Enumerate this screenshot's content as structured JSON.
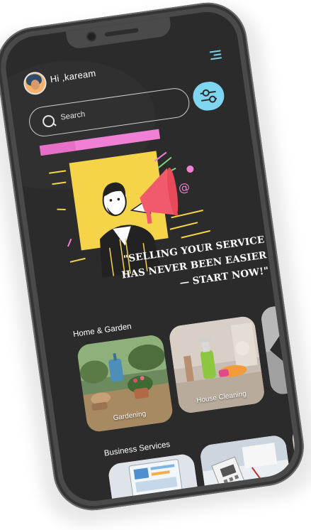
{
  "header": {
    "greeting": "Hi ,kaream",
    "avatar_icon": "user-avatar",
    "menu_icon": "hamburger-menu-icon"
  },
  "search": {
    "placeholder": "Search",
    "icon": "search-icon"
  },
  "filter": {
    "icon": "sliders-icon",
    "color": "#7fd6f0"
  },
  "hero": {
    "quote_line1": "\"SELLING YOUR SERVICE",
    "quote_line2": "HAS NEVER BEEN EASIER",
    "quote_line3": "— START NOW!\"",
    "accent_pink": "#f07fd6",
    "accent_yellow": "#f5d44a",
    "megaphone_color": "#f05a6a"
  },
  "sections": [
    {
      "title": "Home & Garden",
      "cards": [
        {
          "label": "Gardening"
        },
        {
          "label": "House Cleaning"
        },
        {
          "label": ""
        }
      ]
    },
    {
      "title": "Business Services",
      "cards": [
        {
          "label": ""
        },
        {
          "label": ""
        },
        {
          "label": ""
        }
      ]
    }
  ],
  "colors": {
    "screen_bg": "#2b2b2b",
    "phone_frame": "#4a4a4a",
    "text": "#ffffff"
  }
}
